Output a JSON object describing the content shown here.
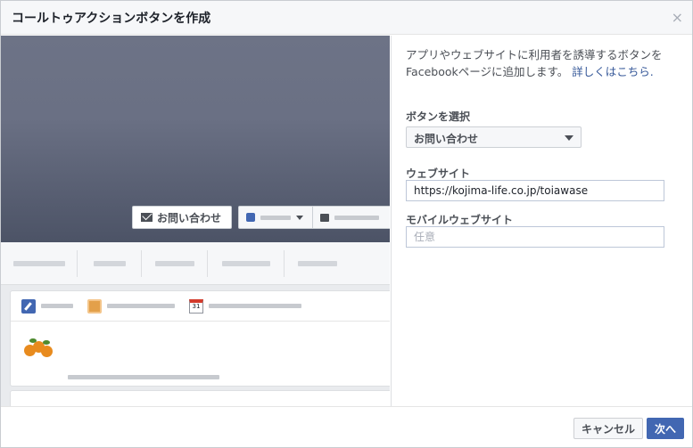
{
  "dialog": {
    "title": "コールトゥアクションボタンを作成",
    "close_label": "×"
  },
  "preview": {
    "cta_label": "お問い合わせ",
    "calendar_day": "31"
  },
  "form": {
    "description": "アプリやウェブサイトに利用者を誘導するボタンをFacebookページに追加します。",
    "learn_more": "詳しくはこちら.",
    "button_select_label": "ボタンを選択",
    "button_select_value": "お問い合わせ",
    "website_label": "ウェブサイト",
    "website_value": "https://kojima-life.co.jp/toiawase",
    "mobile_label": "モバイルウェブサイト",
    "mobile_placeholder": "任意"
  },
  "footer": {
    "cancel_label": "キャンセル",
    "next_label": "次へ"
  },
  "colors": {
    "accent": "#4267b2",
    "link": "#365899"
  },
  "icons": [
    "close-icon",
    "mail-icon",
    "like-icon",
    "caret-down-icon",
    "comment-icon",
    "pencil-icon",
    "photo-icon",
    "calendar-icon"
  ]
}
